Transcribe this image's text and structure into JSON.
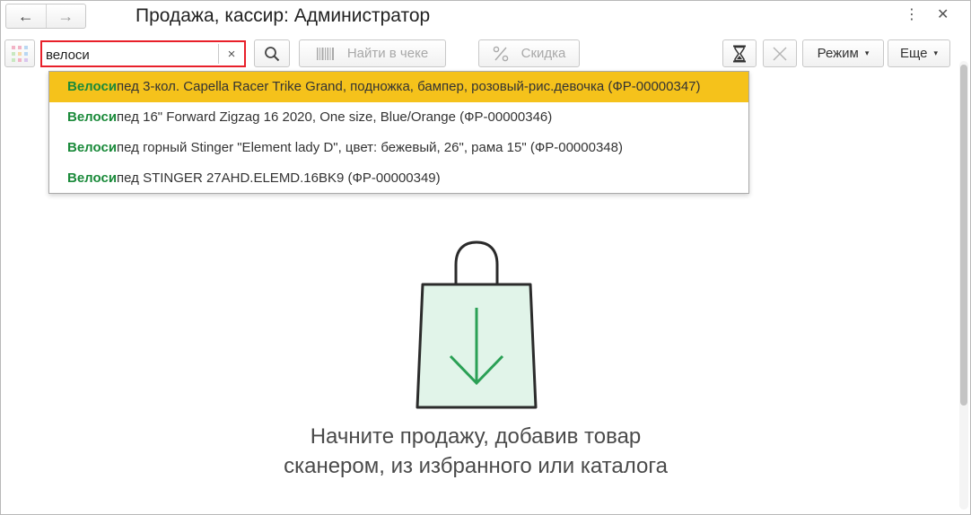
{
  "window": {
    "title": "Продажа, кассир: Администратор",
    "nav_back": "←",
    "nav_forward": "→",
    "more_menu_glyph": "⋮",
    "close_glyph": "✕"
  },
  "toolbar": {
    "search_value": "велоси",
    "clear_glyph": "×",
    "find_in_receipt_label": "Найти в чеке",
    "discount_label": "Скидка",
    "mode_label": "Режим",
    "more_label": "Еще",
    "caret": "▾"
  },
  "suggestions": [
    {
      "match": "Велоси",
      "rest": "пед 3-кол. Capella Racer Trike Grand, подножка, бампер, розовый-рис.девочка (ФР-00000347)",
      "selected": true
    },
    {
      "match": "Велоси",
      "rest": "пед 16\" Forward Zigzag 16 2020, One size, Blue/Orange (ФР-00000346)",
      "selected": false
    },
    {
      "match": "Велоси",
      "rest": "пед горный Stinger \"Element lady D\", цвет: бежевый, 26\", рама 15\" (ФР-00000348)",
      "selected": false
    },
    {
      "match": "Велоси",
      "rest": "пед STINGER 27AHD.ELEMD.16BK9 (ФР-00000349)",
      "selected": false
    }
  ],
  "empty_state": {
    "line1": "Начните продажу, добавив товар",
    "line2": "сканером, из избранного или каталога",
    "icon": "shopping-bag-download-icon"
  },
  "colors": {
    "highlight": "#f5c21b",
    "match_text": "#1a8a3a",
    "search_border": "#e8202a",
    "bag_fill": "#e1f4e9",
    "arrow": "#2aa055"
  }
}
